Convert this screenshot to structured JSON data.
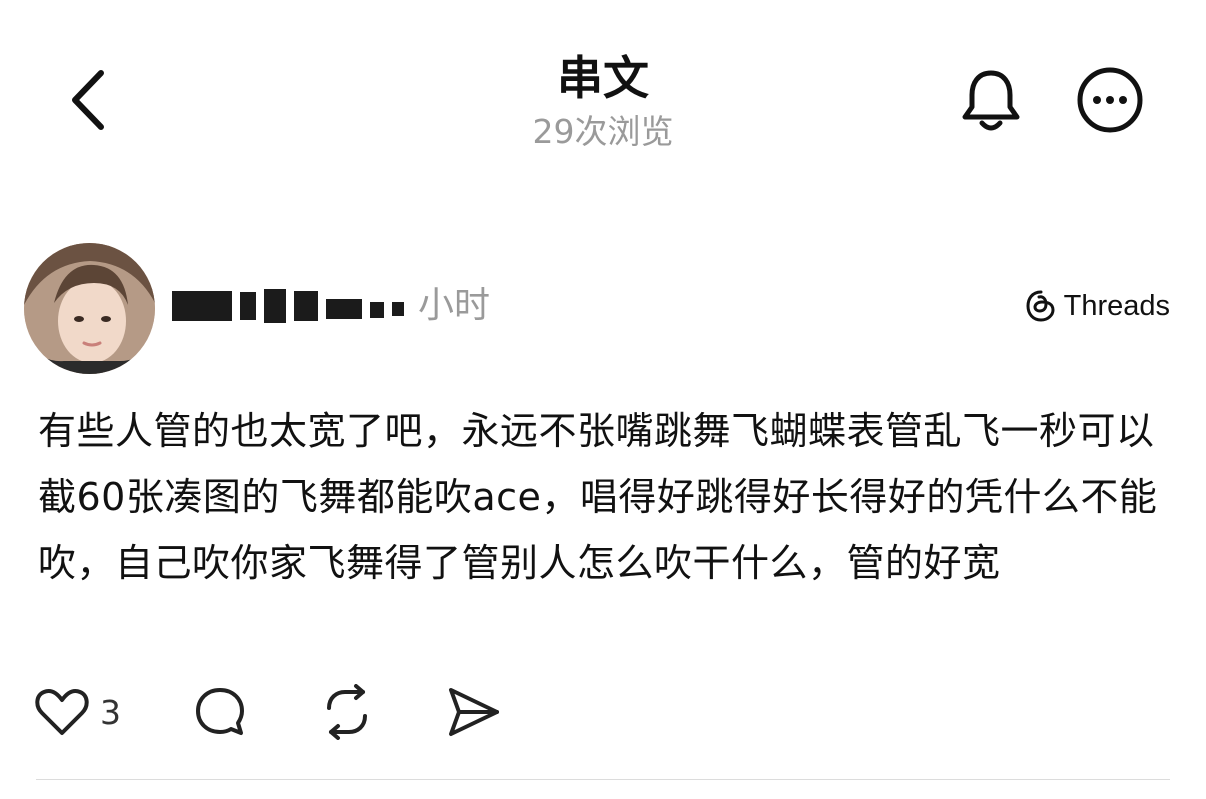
{
  "header": {
    "title": "串文",
    "views": "29次浏览"
  },
  "icons": {
    "back": "chevron-left-icon",
    "bell": "bell-icon",
    "more": "more-horizontal-icon",
    "threads": "threads-logo-icon",
    "like": "heart-icon",
    "comment": "comment-bubble-icon",
    "repost": "repost-icon",
    "share": "send-icon"
  },
  "post": {
    "time_suffix": "小时",
    "source": "Threads",
    "text": "有些人管的也太宽了吧，永远不张嘴跳舞飞蝴蝶表管乱飞一秒可以截60张凑图的飞舞都能吹ace，唱得好跳得好长得好的凭什么不能吹，自己吹你家飞舞得了管别人怎么吹干什么，管的好宽",
    "likes": "3"
  },
  "colors": {
    "text": "#111111",
    "muted": "#9a9a9a",
    "divider": "#dcdcdc",
    "background": "#ffffff"
  }
}
